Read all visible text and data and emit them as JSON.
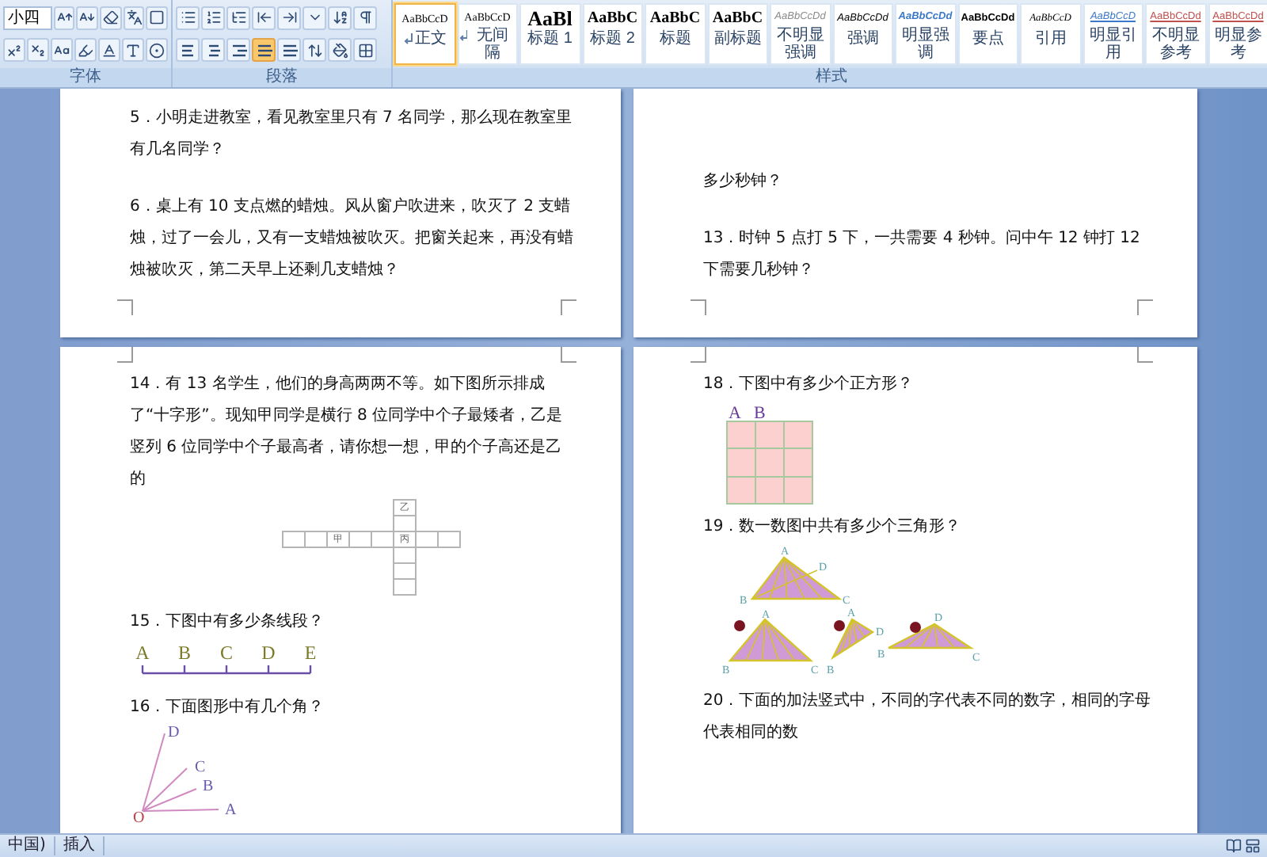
{
  "ribbon": {
    "font_size": "小四",
    "alignment": [
      {
        "selected": false
      },
      {
        "selected": false
      },
      {
        "selected": false
      },
      {
        "selected": true
      },
      {
        "selected": false
      }
    ],
    "styles": [
      {
        "preview": "AaBbCcD",
        "label": "正文",
        "kind": "normal",
        "para_mark": true,
        "selected": true
      },
      {
        "preview": "AaBbCcD",
        "label": "无间隔",
        "kind": "normal",
        "para_mark": true,
        "selected": false
      },
      {
        "preview": "AaBl",
        "label": "标题 1",
        "kind": "heading1",
        "para_mark": false,
        "selected": false
      },
      {
        "preview": "AaBbC",
        "label": "标题 2",
        "kind": "heading2",
        "para_mark": false,
        "selected": false
      },
      {
        "preview": "AaBbC",
        "label": "标题",
        "kind": "heading2",
        "para_mark": false,
        "selected": false
      },
      {
        "preview": "AaBbC",
        "label": "副标题",
        "kind": "heading2",
        "para_mark": false,
        "selected": false
      },
      {
        "preview": "AaBbCcDd",
        "label": "不明显强调",
        "kind": "subtle",
        "para_mark": false,
        "selected": false
      },
      {
        "preview": "AaBbCcDd",
        "label": "强调",
        "kind": "emphasis",
        "para_mark": false,
        "selected": false
      },
      {
        "preview": "AaBbCcDd",
        "label": "明显强调",
        "kind": "intense",
        "para_mark": false,
        "selected": false
      },
      {
        "preview": "AaBbCcDd",
        "label": "要点",
        "kind": "strong",
        "para_mark": false,
        "selected": false
      },
      {
        "preview": "AaBbCcD",
        "label": "引用",
        "kind": "quote",
        "para_mark": false,
        "selected": false
      },
      {
        "preview": "AaBbCcD",
        "label": "明显引用",
        "kind": "intense_quote",
        "para_mark": false,
        "selected": false
      },
      {
        "preview": "AaBbCcDd",
        "label": "不明显参考",
        "kind": "reference",
        "para_mark": false,
        "selected": false
      },
      {
        "preview": "AaBbCcDd",
        "label": "明显参考",
        "kind": "reference",
        "para_mark": false,
        "selected": false
      }
    ],
    "groups": [
      {
        "label": "字体"
      },
      {
        "label": "段落"
      },
      {
        "label": "样式"
      }
    ]
  },
  "pages": [
    {
      "questions": [
        {
          "text": "5．小明走进教室，看见教室里只有 7 名同学，那么现在教室里有几名同学？"
        },
        {
          "text": "6．桌上有 10 支点燃的蜡烛。风从窗户吹进来，吹灭了 2 支蜡烛，过了一会儿，又有一支蜡烛被吹灭。把窗关起来，再没有蜡烛被吹灭，第二天早上还剩几支蜡烛？"
        }
      ]
    },
    {
      "questions": [
        {
          "text": "多少秒钟？"
        },
        {
          "text": "13．时钟 5 点打 5 下，一共需要 4 秒钟。问中午 12 钟打 12 下需要几秒钟？"
        }
      ]
    },
    {
      "questions": [
        {
          "text": "14．有 13 名学生，他们的身高两两不等。如下图所示排成了“十字形”。现知甲同学是横行 8 位同学中个子最矮者，乙是竖列 6 位同学中个子最高者，请你想一想，甲的个子高还是乙的",
          "figure": {
            "kind": "cross",
            "labels": [
              "甲",
              "丙",
              "乙"
            ]
          }
        },
        {
          "text": "15．下图中有多少条线段？",
          "figure": {
            "kind": "segment",
            "labels": [
              "A",
              "B",
              "C",
              "D",
              "E"
            ]
          }
        },
        {
          "text": "16．下面图形中有几个角？",
          "figure": {
            "kind": "angle",
            "labels": [
              "O",
              "A",
              "B",
              "C",
              "D"
            ]
          }
        }
      ]
    },
    {
      "questions": [
        {
          "text": "18．下图中有多少个正方形？",
          "figure": {
            "kind": "squares",
            "labels": [
              "A",
              "B"
            ]
          }
        },
        {
          "text": "19．数一数图中共有多少个三角形？",
          "figure": {
            "kind": "triangles",
            "triangles": [
              {
                "labels": [
                  "A",
                  "D",
                  "B",
                  "C"
                ]
              },
              {
                "labels": [
                  "A",
                  "B",
                  "C"
                ]
              },
              {
                "labels": [
                  "A",
                  "D",
                  "B"
                ]
              },
              {
                "labels": [
                  "D",
                  "B",
                  "C"
                ]
              }
            ]
          }
        },
        {
          "text": "20．下面的加法竖式中，不同的字代表不同的数字，相同的字母代表相同的数"
        }
      ]
    }
  ],
  "status_bar": {
    "language": "中国)",
    "mode": "插入"
  }
}
